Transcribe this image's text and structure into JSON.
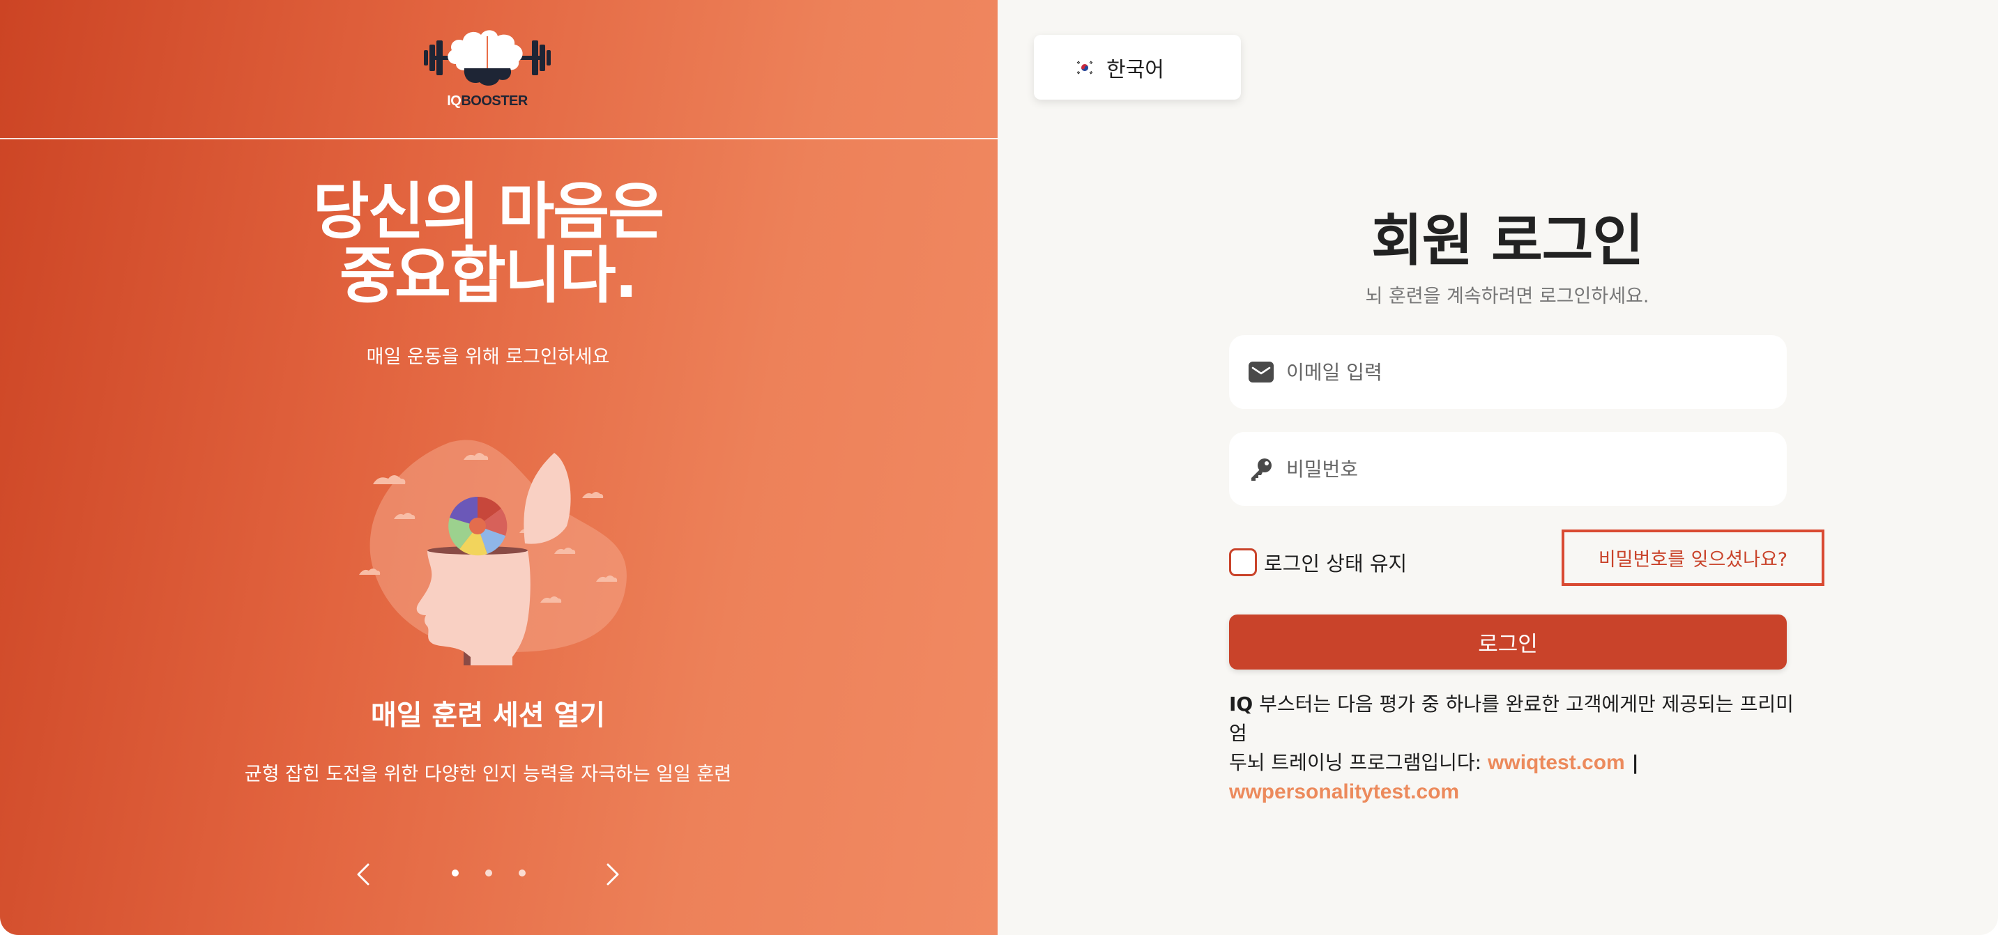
{
  "left_panel": {
    "logo": {
      "text_iq": "IQ",
      "text_booster": "BOOSTER"
    },
    "hero": {
      "title_line1": "당신의 마음은",
      "title_line2": "중요합니다.",
      "subtitle": "매일 운동을 위해 로그인하세요"
    },
    "slide": {
      "title": "매일 훈련 세션 열기",
      "description": "균형 잡힌 도전을 위한 다양한 인지 능력을 자극하는 일일 훈련"
    },
    "carousel": {
      "slide_count": 3,
      "active_index": 0
    },
    "icons": {
      "prev": "chevron-left-icon",
      "next": "chevron-right-icon"
    }
  },
  "right_panel": {
    "language": {
      "label": "한국어",
      "flag": "south-korea-flag-icon"
    },
    "title": "회원 로그인",
    "subtitle": "뇌 훈련을 계속하려면 로그인하세요.",
    "email": {
      "placeholder": "이메일 입력",
      "value": "",
      "icon": "envelope-icon"
    },
    "password": {
      "placeholder": "비밀번호",
      "value": "",
      "icon": "key-icon"
    },
    "remember_me": {
      "label": "로그인 상태 유지",
      "checked": false
    },
    "forgot_password": "비밀번호를 잊으셨나요?",
    "login_button": "로그인",
    "info": {
      "brand": "IQ",
      "text_line1": " 부스터는 다음 평가 중 하나를 완료한 고객에게만 제공되는 프리미엄",
      "text_line2": "두뇌 트레이닝 프로그램입니다: ",
      "link1": "wwiqtest.com",
      "separator": " |",
      "link2": "wwpersonalitytest.com"
    }
  },
  "colors": {
    "accent": "#c9432a",
    "link": "#ec8a5c",
    "left_gradient_start": "#cc4424",
    "left_gradient_end": "#f18a63",
    "right_background": "#f8f7f4"
  }
}
